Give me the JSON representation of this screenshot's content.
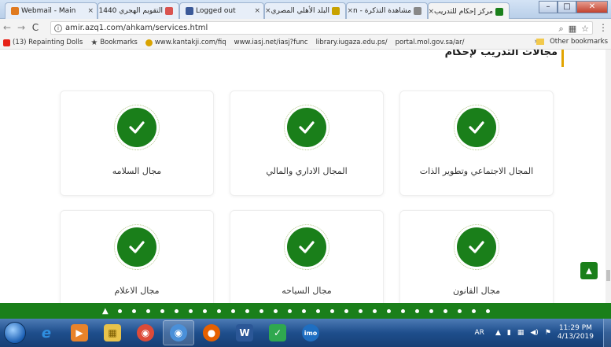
{
  "browser": {
    "tabs": [
      {
        "label": "Webmail - Main",
        "fav_color": "#e07a20"
      },
      {
        "label": "التقويم الهجري 1440",
        "fav_color": "#d9534f"
      },
      {
        "label": "Logged out",
        "fav_color": "#3b5998"
      },
      {
        "label": "البلد الأهلي المصري",
        "fav_color": "#c8a200"
      },
      {
        "label": "مشاهدة التذكرة - n",
        "fav_color": "#888888"
      },
      {
        "label": "مركز إحكام للتدريب",
        "fav_color": "#1a7f1a"
      }
    ],
    "active_tab_index": 5,
    "address": "amir.azq1.com/ahkam/services.html",
    "bookmarks": [
      {
        "label": "(13) Repainting Dolls",
        "icon": "youtube-icon"
      },
      {
        "label": "Bookmarks",
        "icon": "star-icon"
      },
      {
        "label": "www.kantakji.com/fiq",
        "icon": "globe-icon"
      },
      {
        "label": "www.iasj.net/iasj?func",
        "icon": "page-icon"
      },
      {
        "label": "library.iugaza.edu.ps/",
        "icon": "page-icon"
      },
      {
        "label": "portal.mol.gov.sa/ar/",
        "icon": "page-icon"
      }
    ],
    "more_bookmarks": "»",
    "other_bookmarks": "Other bookmarks"
  },
  "page": {
    "heading": "مجالات التدريب لإحكام",
    "cards": [
      {
        "label": "مجال السلامه"
      },
      {
        "label": "المجال الاداري والمالي"
      },
      {
        "label": "المجال الاجتماعي وتطوير الذات"
      },
      {
        "label": "مجال الاعلام"
      },
      {
        "label": "مجال السياحه"
      },
      {
        "label": "مجال القانون"
      }
    ],
    "accent_color": "#1a7f1a",
    "heading_bar_color": "#e2a400"
  },
  "taskbar": {
    "apps": [
      {
        "name": "internet-explorer-icon",
        "glyph": "e",
        "color": "#2f8fe0"
      },
      {
        "name": "media-player-icon",
        "glyph": "▶",
        "color": "#e8832a"
      },
      {
        "name": "file-explorer-icon",
        "glyph": "▦",
        "color": "#e8c24a"
      },
      {
        "name": "chrome-icon",
        "glyph": "◉",
        "color": "#dd4b39"
      },
      {
        "name": "chrome-alt-icon",
        "glyph": "◉",
        "color": "#4a90d9"
      },
      {
        "name": "firefox-icon",
        "glyph": "●",
        "color": "#e66000"
      },
      {
        "name": "word-icon",
        "glyph": "W",
        "color": "#2b5797"
      },
      {
        "name": "shield-icon",
        "glyph": "✓",
        "color": "#2fa84f"
      },
      {
        "name": "imo-icon",
        "glyph": "imo",
        "color": "#1f6fc2"
      }
    ],
    "language": "AR",
    "time": "11:29 PM",
    "date": "4/13/2019"
  }
}
